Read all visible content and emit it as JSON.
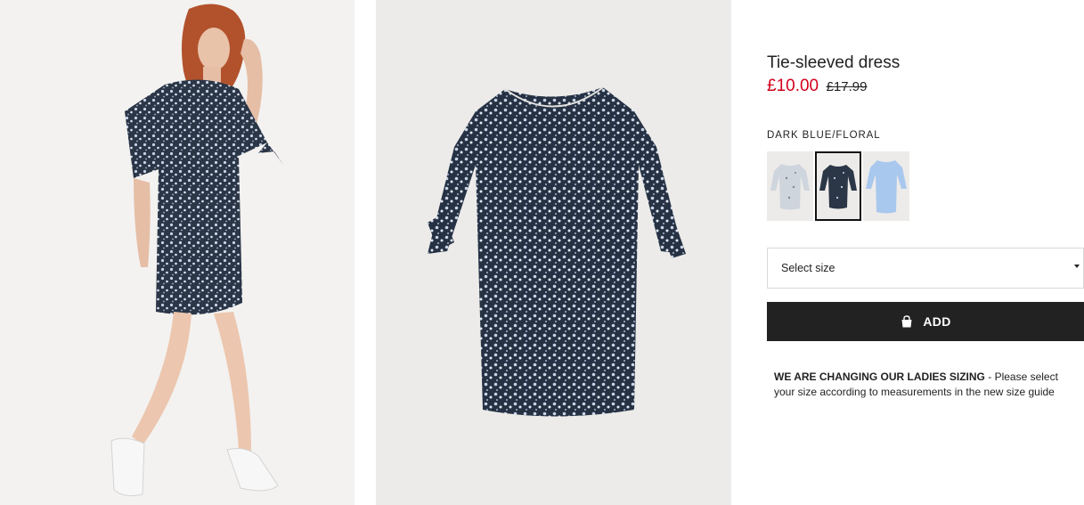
{
  "product": {
    "title": "Tie-sleeved dress",
    "price_sale": "£10.00",
    "price_old": "£17.99",
    "color_name": "DARK BLUE/FLORAL",
    "swatches": [
      {
        "name": "light floral",
        "active": false
      },
      {
        "name": "dark blue floral",
        "active": true
      },
      {
        "name": "light blue",
        "active": false
      }
    ]
  },
  "size_select": {
    "placeholder": "Select size"
  },
  "add_button": {
    "label": "ADD",
    "icon": "shopping-bag-icon"
  },
  "notice": {
    "heading": "WE ARE CHANGING OUR LADIES SIZING",
    "text": " - Please select your size according to measurements in the new size guide"
  },
  "colors": {
    "sale": "#d0021b",
    "button": "#222222",
    "dress_dark": "#2b3647",
    "dress_print": "#c9d3e6",
    "dress_light_blue": "#a9c8ee"
  }
}
